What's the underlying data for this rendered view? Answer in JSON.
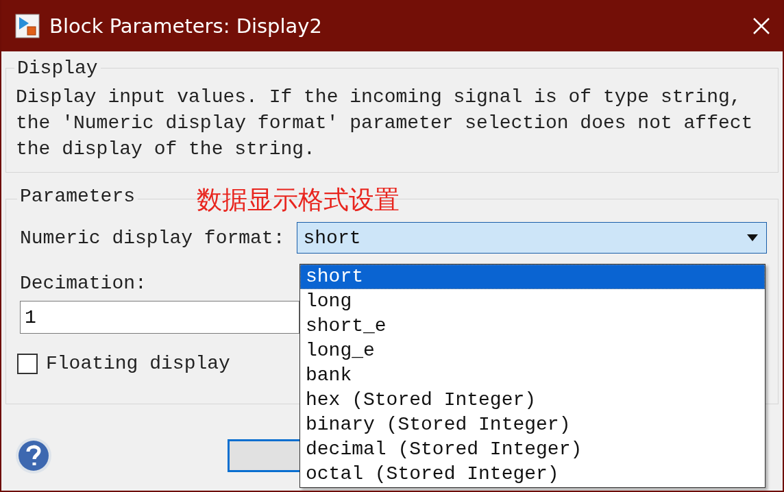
{
  "window": {
    "title": "Block Parameters: Display2"
  },
  "description": {
    "title": "Display",
    "text": "Display input values. If the incoming signal is of type string, the 'Numeric display format' parameter selection does not affect the display of the string."
  },
  "parameters": {
    "title": "Parameters",
    "annotation": "数据显示格式设置",
    "format": {
      "label": "Numeric display format:",
      "value": "short",
      "expanded": true,
      "options": [
        {
          "label": "short",
          "selected": true
        },
        {
          "label": "long",
          "selected": false
        },
        {
          "label": "short_e",
          "selected": false
        },
        {
          "label": "long_e",
          "selected": false
        },
        {
          "label": "bank",
          "selected": false
        },
        {
          "label": "hex (Stored Integer)",
          "selected": false
        },
        {
          "label": "binary (Stored Integer)",
          "selected": false
        },
        {
          "label": "decimal (Stored Integer)",
          "selected": false
        },
        {
          "label": "octal (Stored Integer)",
          "selected": false
        }
      ]
    },
    "decimation": {
      "label": "Decimation:",
      "value": "1"
    },
    "floating_display": {
      "label": "Floating display",
      "checked": false
    }
  }
}
